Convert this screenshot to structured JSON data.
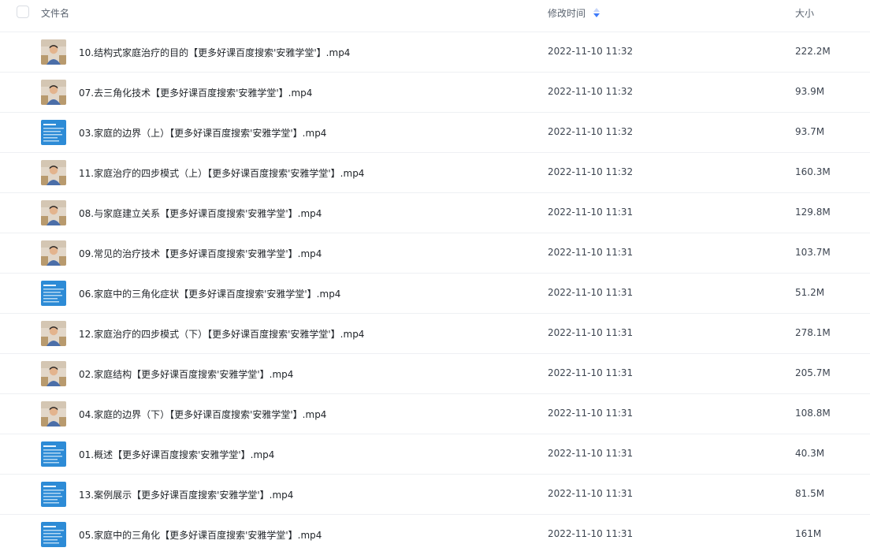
{
  "header": {
    "name_label": "文件名",
    "mtime_label": "修改时间",
    "size_label": "大小"
  },
  "colors": {
    "sort_up": "#c6d5f8",
    "sort_down": "#3e7bfa",
    "thumb_person_bg": "#e2d7c9",
    "thumb_slide_bg": "#2d8bd6"
  },
  "files": [
    {
      "name": "10.结构式家庭治疗的目的【更多好课百度搜索'安雅学堂'】.mp4",
      "mtime": "2022-11-10 11:32",
      "size": "222.2M",
      "thumb": "person-thumbnail"
    },
    {
      "name": "07.去三角化技术【更多好课百度搜索'安雅学堂'】.mp4",
      "mtime": "2022-11-10 11:32",
      "size": "93.9M",
      "thumb": "person-thumbnail"
    },
    {
      "name": "03.家庭的边界（上）【更多好课百度搜索'安雅学堂'】.mp4",
      "mtime": "2022-11-10 11:32",
      "size": "93.7M",
      "thumb": "slide-thumbnail"
    },
    {
      "name": "11.家庭治疗的四步模式（上）【更多好课百度搜索'安雅学堂'】.mp4",
      "mtime": "2022-11-10 11:32",
      "size": "160.3M",
      "thumb": "person-thumbnail"
    },
    {
      "name": "08.与家庭建立关系【更多好课百度搜索'安雅学堂'】.mp4",
      "mtime": "2022-11-10 11:31",
      "size": "129.8M",
      "thumb": "person-thumbnail"
    },
    {
      "name": "09.常见的治疗技术【更多好课百度搜索'安雅学堂'】.mp4",
      "mtime": "2022-11-10 11:31",
      "size": "103.7M",
      "thumb": "person-thumbnail"
    },
    {
      "name": "06.家庭中的三角化症状【更多好课百度搜索'安雅学堂'】.mp4",
      "mtime": "2022-11-10 11:31",
      "size": "51.2M",
      "thumb": "slide-thumbnail"
    },
    {
      "name": "12.家庭治疗的四步模式（下）【更多好课百度搜索'安雅学堂'】.mp4",
      "mtime": "2022-11-10 11:31",
      "size": "278.1M",
      "thumb": "person-thumbnail"
    },
    {
      "name": "02.家庭结构【更多好课百度搜索'安雅学堂'】.mp4",
      "mtime": "2022-11-10 11:31",
      "size": "205.7M",
      "thumb": "person-thumbnail"
    },
    {
      "name": "04.家庭的边界（下）【更多好课百度搜索'安雅学堂'】.mp4",
      "mtime": "2022-11-10 11:31",
      "size": "108.8M",
      "thumb": "person-thumbnail"
    },
    {
      "name": "01.概述【更多好课百度搜索'安雅学堂'】.mp4",
      "mtime": "2022-11-10 11:31",
      "size": "40.3M",
      "thumb": "slide-thumbnail"
    },
    {
      "name": "13.案例展示【更多好课百度搜索'安雅学堂'】.mp4",
      "mtime": "2022-11-10 11:31",
      "size": "81.5M",
      "thumb": "slide-thumbnail"
    },
    {
      "name": "05.家庭中的三角化【更多好课百度搜索'安雅学堂'】.mp4",
      "mtime": "2022-11-10 11:31",
      "size": "161M",
      "thumb": "slide-thumbnail"
    }
  ]
}
